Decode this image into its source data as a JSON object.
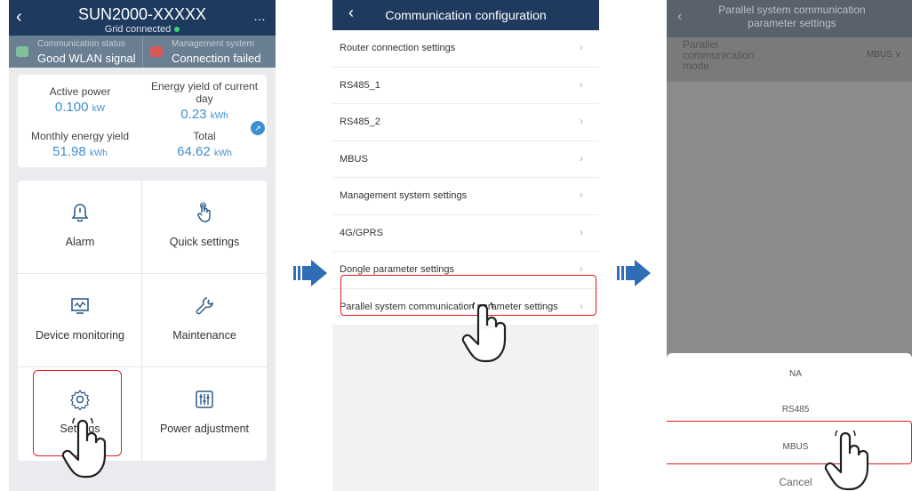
{
  "phone1": {
    "device_title": "SUN2000-XXXXX",
    "grid_status": "Grid connected",
    "comm_status_label": "Communication status",
    "comm_status_value": "Good WLAN signal",
    "mgmt_system_label": "Management system",
    "mgmt_system_value": "Connection failed",
    "energy": [
      {
        "label": "Active power",
        "value": "0.100",
        "unit": "kW"
      },
      {
        "label": "Energy yield of current day",
        "value": "0.23",
        "unit": "kWh"
      },
      {
        "label": "Monthly energy yield",
        "value": "51.98",
        "unit": "kWh"
      },
      {
        "label": "Total",
        "value": "64.62",
        "unit": "kWh"
      }
    ],
    "tiles": [
      {
        "label": "Alarm",
        "icon": "alarm-bell-icon"
      },
      {
        "label": "Quick settings",
        "icon": "hand-pointer-icon"
      },
      {
        "label": "Device monitoring",
        "icon": "monitor-chart-icon"
      },
      {
        "label": "Maintenance",
        "icon": "wrench-icon"
      },
      {
        "label": "Settings",
        "icon": "gear-icon"
      },
      {
        "label": "Power adjustment",
        "icon": "sliders-icon"
      }
    ]
  },
  "phone2": {
    "title": "Communication configuration",
    "items": [
      "Router connection settings",
      "RS485_1",
      "RS485_2",
      "MBUS",
      "Management system settings",
      "4G/GPRS",
      "Dongle parameter settings",
      "Parallel system communication parameter settings"
    ]
  },
  "phone3": {
    "title": "Parallel system communication parameter settings",
    "field_label": "Parallel communication mode",
    "field_value": "MBUS",
    "options": [
      "NA",
      "RS485",
      "MBUS"
    ],
    "cancel": "Cancel"
  },
  "colors": {
    "header": "#1f3a5f",
    "accent_blue": "#3f8fd0",
    "highlight_red": "#e21b1b",
    "arrow_blue": "#2f6db5"
  }
}
